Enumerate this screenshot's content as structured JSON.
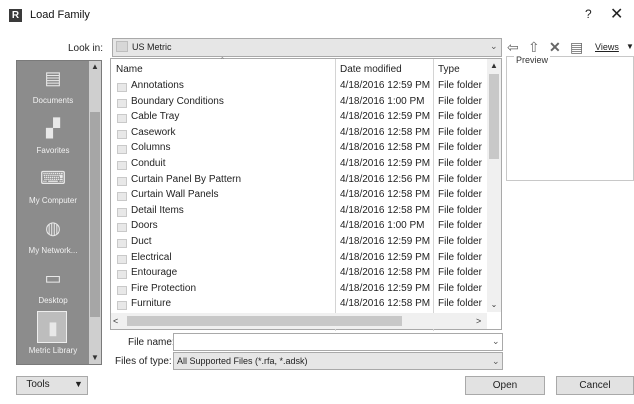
{
  "window": {
    "app_icon": "R",
    "title": "Load Family",
    "help": "?",
    "close": "✕"
  },
  "lookin": {
    "label": "Look in:",
    "value": "US Metric"
  },
  "toolbar": {
    "back_icon": "⇦",
    "up_icon": "⇧",
    "delete_icon": "✕",
    "newfolder_icon": "▤",
    "views_label": "Views"
  },
  "preview": {
    "label": "Preview"
  },
  "places": [
    {
      "label": "Documents",
      "icon": "documents-icon",
      "glyph": "▤"
    },
    {
      "label": "Favorites",
      "icon": "favorites-icon",
      "glyph": "▞"
    },
    {
      "label": "My Computer",
      "icon": "computer-icon",
      "glyph": "⌨"
    },
    {
      "label": "My Network...",
      "icon": "network-icon",
      "glyph": "◍"
    },
    {
      "label": "Desktop",
      "icon": "desktop-icon",
      "glyph": "▭"
    },
    {
      "label": "Metric Library",
      "icon": "library-icon",
      "glyph": "▮"
    }
  ],
  "columns": {
    "name": "Name",
    "date": "Date modified",
    "type": "Type"
  },
  "files": [
    {
      "name": "Annotations",
      "date": "4/18/2016 12:59 PM",
      "type": "File folder"
    },
    {
      "name": "Boundary Conditions",
      "date": "4/18/2016 1:00 PM",
      "type": "File folder"
    },
    {
      "name": "Cable Tray",
      "date": "4/18/2016 12:59 PM",
      "type": "File folder"
    },
    {
      "name": "Casework",
      "date": "4/18/2016 12:58 PM",
      "type": "File folder"
    },
    {
      "name": "Columns",
      "date": "4/18/2016 12:58 PM",
      "type": "File folder"
    },
    {
      "name": "Conduit",
      "date": "4/18/2016 12:59 PM",
      "type": "File folder"
    },
    {
      "name": "Curtain Panel By Pattern",
      "date": "4/18/2016 12:56 PM",
      "type": "File folder"
    },
    {
      "name": "Curtain Wall Panels",
      "date": "4/18/2016 12:58 PM",
      "type": "File folder"
    },
    {
      "name": "Detail Items",
      "date": "4/18/2016 12:58 PM",
      "type": "File folder"
    },
    {
      "name": "Doors",
      "date": "4/18/2016 1:00 PM",
      "type": "File folder"
    },
    {
      "name": "Duct",
      "date": "4/18/2016 12:59 PM",
      "type": "File folder"
    },
    {
      "name": "Electrical",
      "date": "4/18/2016 12:59 PM",
      "type": "File folder"
    },
    {
      "name": "Entourage",
      "date": "4/18/2016 12:58 PM",
      "type": "File folder"
    },
    {
      "name": "Fire Protection",
      "date": "4/18/2016 12:59 PM",
      "type": "File folder"
    },
    {
      "name": "Furniture",
      "date": "4/18/2016 12:58 PM",
      "type": "File folder"
    }
  ],
  "filename": {
    "label": "File name:",
    "value": ""
  },
  "filetype": {
    "label": "Files of type:",
    "value": "All Supported Files  (*.rfa, *.adsk)"
  },
  "buttons": {
    "tools": "Tools",
    "open": "Open",
    "cancel": "Cancel"
  }
}
